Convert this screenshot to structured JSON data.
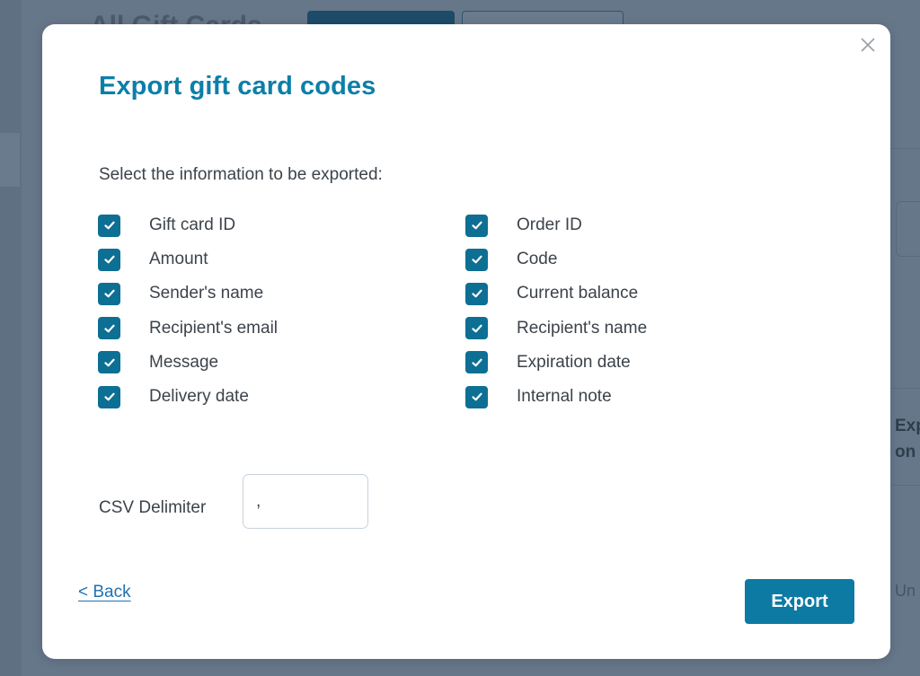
{
  "background": {
    "page_title": "All Gift Cards",
    "right_panel_heading": "Export gift card codes on",
    "right_panel_heading_lines": [
      "Exp",
      "on"
    ],
    "right_panel_status": "Un"
  },
  "modal": {
    "title": "Export gift card codes",
    "close_icon": "close-icon",
    "instructions": "Select the information to be exported:",
    "options": [
      {
        "label": "Gift card ID",
        "checked": true
      },
      {
        "label": "Order ID",
        "checked": true
      },
      {
        "label": "Amount",
        "checked": true
      },
      {
        "label": "Code",
        "checked": true
      },
      {
        "label": "Sender's name",
        "checked": true
      },
      {
        "label": "Current balance",
        "checked": true
      },
      {
        "label": "Recipient's email",
        "checked": true
      },
      {
        "label": "Recipient's name",
        "checked": true
      },
      {
        "label": "Message",
        "checked": true
      },
      {
        "label": "Expiration date",
        "checked": true
      },
      {
        "label": "Delivery date",
        "checked": true
      },
      {
        "label": "Internal note",
        "checked": true
      }
    ],
    "csv_delimiter": {
      "label": "CSV Delimiter",
      "value": ","
    },
    "back_label": "< Back",
    "export_label": "Export"
  },
  "colors": {
    "accent": "#0c7fa8",
    "checkbox": "#0d6f93",
    "button": "#0d7aa3",
    "link": "#2271b1",
    "overlay": "#66778a"
  }
}
